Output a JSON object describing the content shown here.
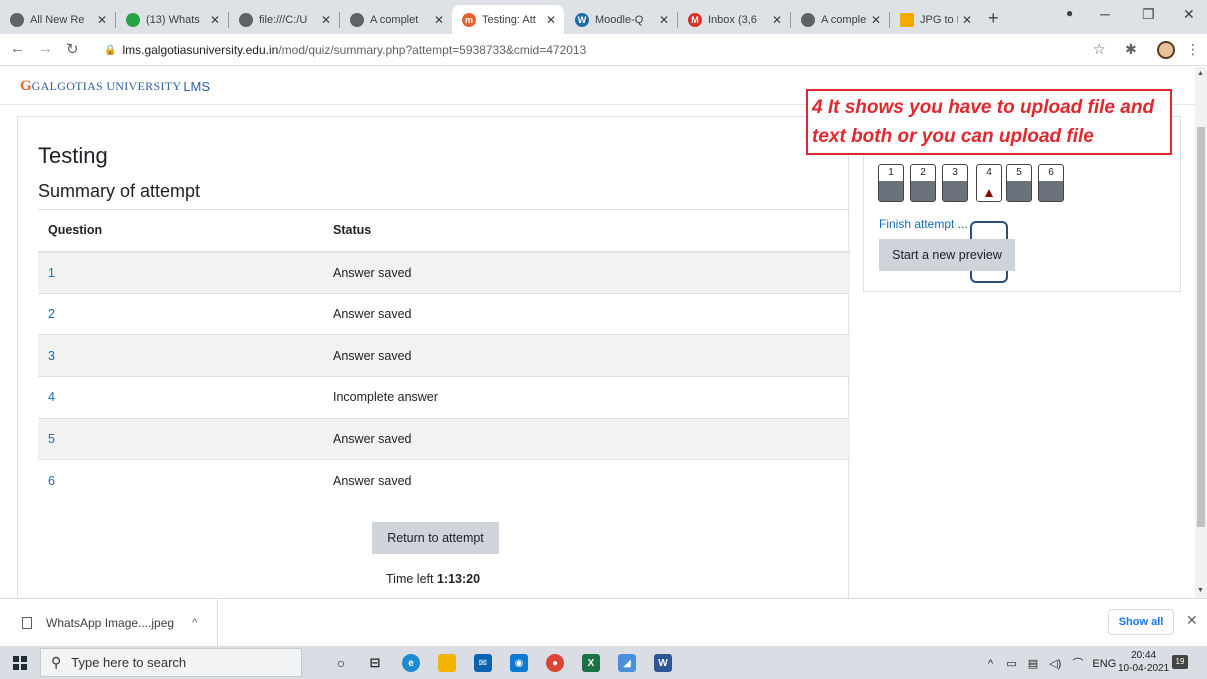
{
  "browser": {
    "tabs": [
      {
        "label": "All New Re",
        "color": "#5f6368"
      },
      {
        "label": "(13) Whats",
        "color": "#25a244",
        "badge": "13"
      },
      {
        "label": "file:///C:/U",
        "color": "#5f6368"
      },
      {
        "label": "A complet",
        "color": "#5f6368"
      },
      {
        "label": "Testing: Att",
        "color": "#e8632e",
        "active": true
      },
      {
        "label": "Moodle-Q",
        "color": "#1b6fa8"
      },
      {
        "label": "Inbox (3,6",
        "color": "#d93025"
      },
      {
        "label": "A complet",
        "color": "#5f6368"
      },
      {
        "label": "JPG to PDF",
        "color": "#f2a900"
      }
    ],
    "new_tab": "+",
    "url_host": "lms.galgotiasuniversity.edu.in",
    "url_path": "/mod/quiz/summary.php?attempt=5938733&cmid=472013"
  },
  "site": {
    "logo_text": "GALGOTIAS UNIVERSITY",
    "lms": "LMS"
  },
  "quiz": {
    "title": "Testing",
    "summary_heading": "Summary of attempt",
    "columns": [
      "Question",
      "Status"
    ],
    "rows": [
      {
        "q": "1",
        "status": "Answer saved"
      },
      {
        "q": "2",
        "status": "Answer saved"
      },
      {
        "q": "3",
        "status": "Answer saved"
      },
      {
        "q": "4",
        "status": "Incomplete answer"
      },
      {
        "q": "5",
        "status": "Answer saved"
      },
      {
        "q": "6",
        "status": "Answer saved"
      }
    ],
    "return_button": "Return to attempt",
    "time_left_label": "Time left",
    "time_left_value": "1:13:20"
  },
  "navigation": {
    "buttons": [
      "1",
      "2",
      "3",
      "4",
      "5",
      "6"
    ],
    "incomplete_question": "4",
    "finish_link": "Finish attempt ...",
    "preview_button": "Start a new preview"
  },
  "annotation": {
    "text": "4 It shows you have to upload file and text both or you can upload file",
    "color": "#e0282e"
  },
  "downloads": {
    "file": "WhatsApp Image....jpeg",
    "show_all": "Show all"
  },
  "taskbar": {
    "search_placeholder": "Type here to search",
    "lang": "ENG",
    "time": "20:44",
    "date": "10-04-2021",
    "notifications": "19"
  }
}
